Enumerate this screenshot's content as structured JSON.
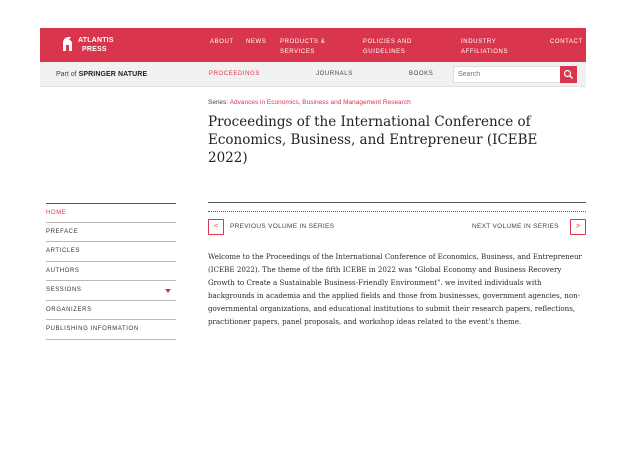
{
  "brand": {
    "logo_line1": "ATLANTIS",
    "logo_line2": "PRESS",
    "accent": "#d9364d"
  },
  "top_nav": {
    "items": [
      {
        "label": "ABOUT"
      },
      {
        "label": "NEWS"
      },
      {
        "label": "PRODUCTS & SERVICES"
      },
      {
        "label": "POLICIES AND GUIDELINES"
      },
      {
        "label": "INDUSTRY AFFILIATIONS"
      },
      {
        "label": "CONTACT"
      }
    ]
  },
  "sub_nav": {
    "part_of_prefix": "Part of",
    "part_of_brand": "SPRINGER NATURE",
    "items": [
      {
        "label": "PROCEEDINGS",
        "active": true
      },
      {
        "label": "JOURNALS",
        "active": false
      },
      {
        "label": "BOOKS",
        "active": false
      }
    ],
    "search_placeholder": "Search"
  },
  "series": {
    "prefix": "Series:",
    "name": "Advances in Economics, Business and Management Research"
  },
  "title": "Proceedings of the International Conference of Economics, Business, and Entrepreneur (ICEBE 2022)",
  "sidebar": {
    "items": [
      {
        "label": "HOME",
        "active": true
      },
      {
        "label": "PREFACE"
      },
      {
        "label": "ARTICLES"
      },
      {
        "label": "AUTHORS"
      },
      {
        "label": "SESSIONS",
        "has_dropdown": true
      },
      {
        "label": "ORGANIZERS"
      },
      {
        "label": "PUBLISHING INFORMATION"
      }
    ]
  },
  "volume_nav": {
    "previous": "PREVIOUS VOLUME IN SERIES",
    "next": "NEXT VOLUME IN SERIES"
  },
  "intro_text": "Welcome to the Proceedings of the International Conference of Economics, Business, and Entrepreneur (ICEBE 2022). The theme of the fifth ICEBE in 2022 was \"Global Economy and Business Recovery Growth to Create a Sustainable Business-Friendly Environment\". we invited individuals with backgrounds in academia and the applied fields and those from businesses, government agencies, non-governmental organizations, and educational institutions to submit their research papers, reflections, practitioner papers, panel proposals, and workshop ideas related to the event's theme."
}
